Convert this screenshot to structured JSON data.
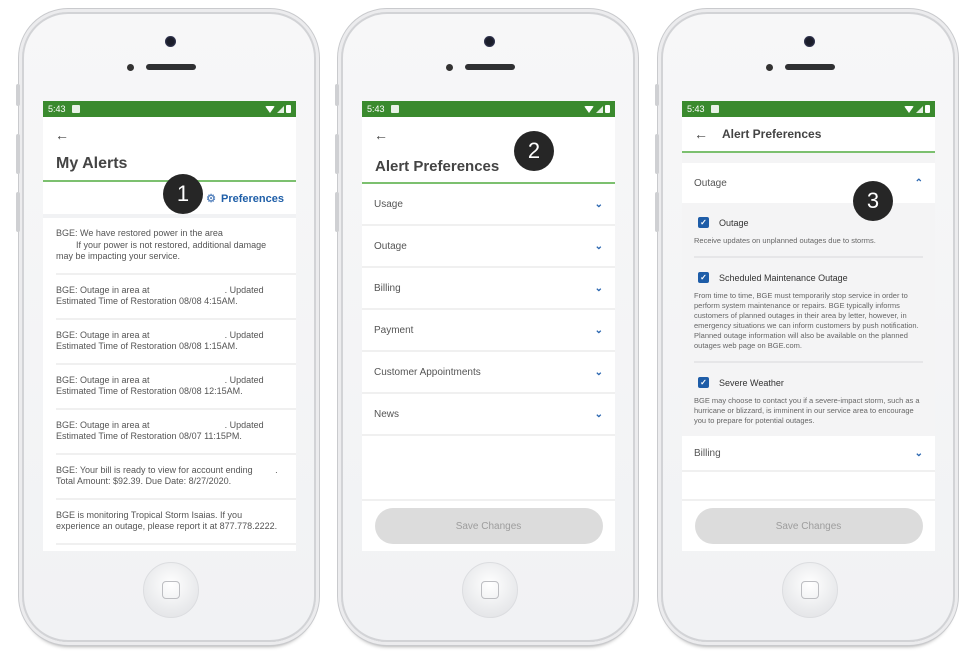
{
  "status_bar": {
    "time": "5:43"
  },
  "screen1": {
    "title": "My Alerts",
    "preferences_label": "Preferences",
    "alerts": [
      {
        "lines": [
          "BGE: We have restored power in the area",
          "        If your power is not restored, additional damage",
          "may be impacting your service."
        ]
      },
      {
        "lines": [
          "BGE: Outage in area at                              . Updated",
          "Estimated Time of Restoration 08/08 4:15AM."
        ]
      },
      {
        "lines": [
          "BGE: Outage in area at                              . Updated",
          "Estimated Time of Restoration 08/08 1:15AM."
        ]
      },
      {
        "lines": [
          "BGE: Outage in area at                              . Updated",
          "Estimated Time of Restoration 08/08 12:15AM."
        ]
      },
      {
        "lines": [
          "BGE: Outage in area at                              . Updated",
          "Estimated Time of Restoration 08/07 11:15PM."
        ]
      },
      {
        "lines": [
          "BGE: Your bill is ready to view for account ending         .",
          "Total Amount: $92.39. Due Date: 8/27/2020."
        ]
      },
      {
        "lines": [
          "BGE is monitoring Tropical Storm Isaias. If you",
          "experience an outage, please report it at 877.778.2222."
        ]
      }
    ]
  },
  "screen2": {
    "title": "Alert Preferences",
    "categories": [
      "Usage",
      "Outage",
      "Billing",
      "Payment",
      "Customer Appointments",
      "News"
    ],
    "save_label": "Save Changes"
  },
  "screen3": {
    "title": "Alert Preferences",
    "expanded_category": "Outage",
    "options": [
      {
        "label": "Outage",
        "checked": true,
        "description": "Receive updates on unplanned outages due to storms."
      },
      {
        "label": "Scheduled Maintenance Outage",
        "checked": true,
        "description": "From time to time, BGE must temporarily stop service in order to perform system maintenance or repairs. BGE typically informs customers of planned outages in their area by letter, however, in emergency situations we can inform customers by push notification. Planned outage information will also be available on the planned outages web page on BGE.com."
      },
      {
        "label": "Severe Weather",
        "checked": true,
        "description": "BGE may choose to contact you if a severe-impact storm, such as a hurricane or blizzard, is imminent in our service area to encourage you to prepare for potential outages."
      }
    ],
    "next_category": "Billing",
    "save_label": "Save Changes"
  },
  "badges": [
    "1",
    "2",
    "3"
  ],
  "icons": {
    "back": "←",
    "gear": "⚙",
    "chevron_down": "⌄",
    "chevron_up": "⌃",
    "check": "✓"
  },
  "colors": {
    "status_bar": "#3a8a2e",
    "accent_line": "#7cc06f",
    "link": "#1f5fa8",
    "checkbox": "#1e5da8"
  }
}
